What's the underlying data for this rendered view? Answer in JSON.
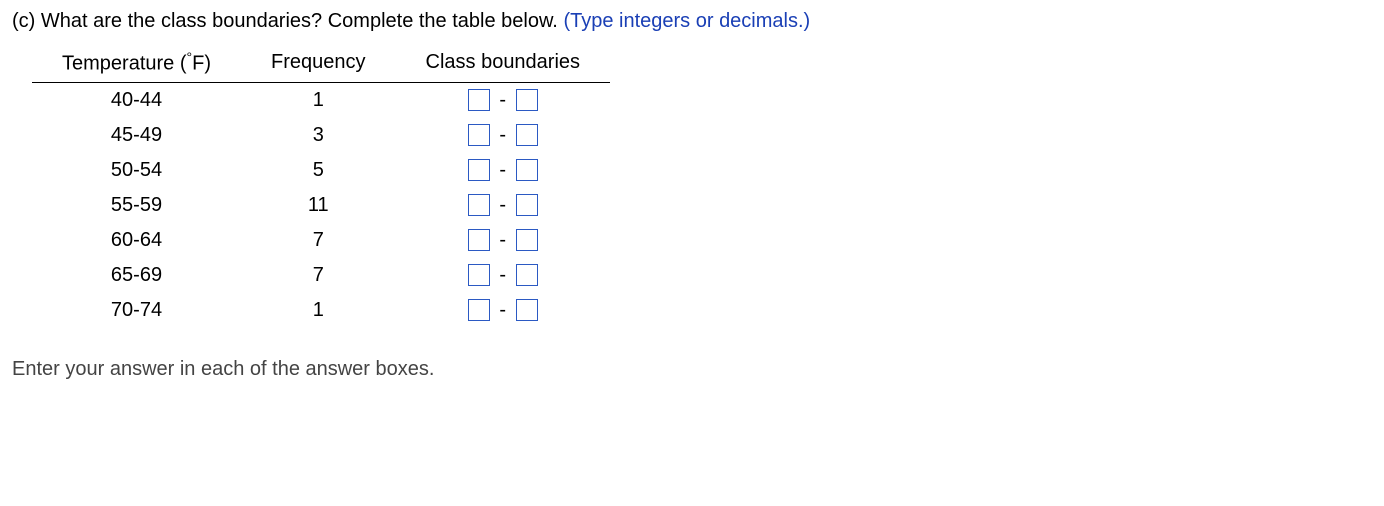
{
  "prompt": {
    "part_label": "(c)",
    "question": "What are the class boundaries? Complete the table below.",
    "hint": "(Type integers or decimals.)"
  },
  "table": {
    "headers": {
      "col1": "Temperature (",
      "col1_unit_prefix": "°",
      "col1_unit": "F)",
      "col2": "Frequency",
      "col3": "Class boundaries"
    },
    "rows": [
      {
        "range": "40-44",
        "freq": "1"
      },
      {
        "range": "45-49",
        "freq": "3"
      },
      {
        "range": "50-54",
        "freq": "5"
      },
      {
        "range": "55-59",
        "freq": "11"
      },
      {
        "range": "60-64",
        "freq": "7"
      },
      {
        "range": "65-69",
        "freq": "7"
      },
      {
        "range": "70-74",
        "freq": "1"
      }
    ],
    "boundary_separator": "-"
  },
  "footer": "Enter your answer in each of the answer boxes."
}
